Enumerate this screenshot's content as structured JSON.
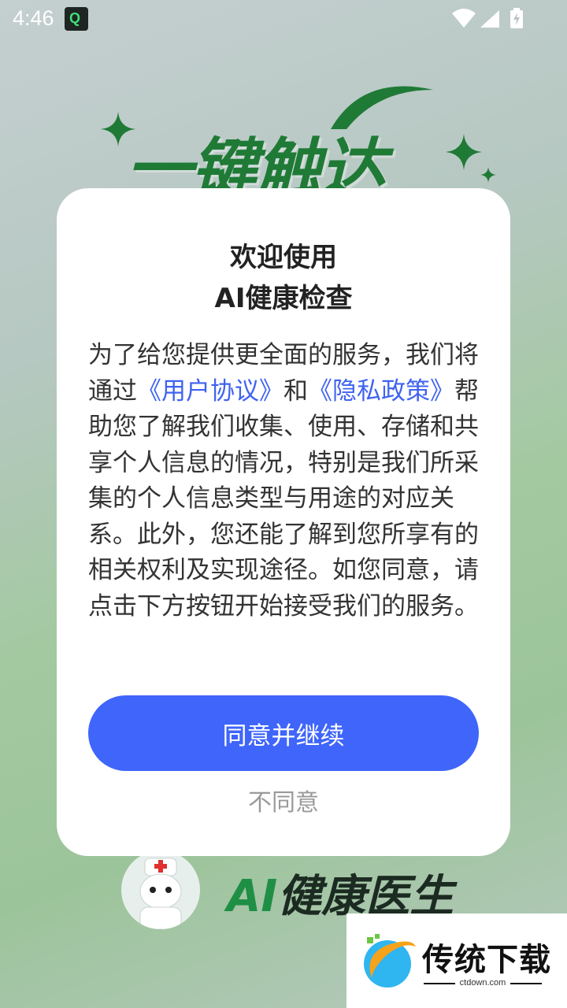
{
  "status_bar": {
    "time": "4:46",
    "app_icon": "app-logo-icon",
    "icons": [
      "wifi-icon",
      "signal-icon",
      "battery-charging-icon"
    ]
  },
  "hero": {
    "title": "一键触达"
  },
  "dialog": {
    "title_line1": "欢迎使用",
    "title_line2": "AI健康检查",
    "body": {
      "part1": "为了给您提供更全面的服务，我们将通过",
      "link1": "《用户协议》",
      "part2": "和",
      "link2": "《隐私政策》",
      "part3": "帮助您了解我们收集、使用、存储和共享个人信息的情况，特别是我们所采集的个人信息类型与用途的对应关系。此外，您还能了解到您所享有的相关权利及实现途径。如您同意，请点击下方按钮开始接受我们的服务。"
    },
    "agree_button": "同意并继续",
    "disagree_button": "不同意"
  },
  "brand": {
    "ai": "AI",
    "name": "健康医生"
  },
  "watermark": {
    "name": "传统下载",
    "url": "ctdown.com"
  },
  "colors": {
    "accent": "#3f65fb",
    "link": "#3f63f0",
    "brand_green": "#1f7a36"
  }
}
